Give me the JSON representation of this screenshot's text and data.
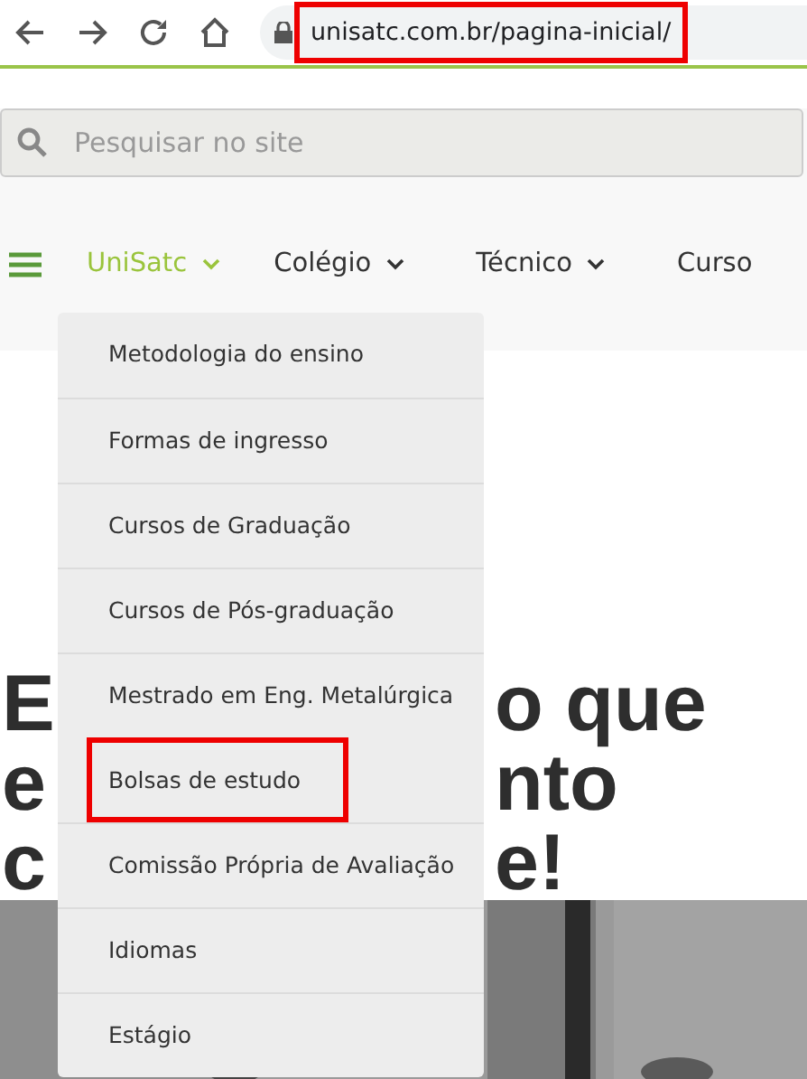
{
  "browser": {
    "url": "unisatc.com.br/pagina-inicial/",
    "url_highlighted": true
  },
  "search": {
    "placeholder": "Pesquisar no site"
  },
  "nav": [
    {
      "label": "UniSatc",
      "selected": true
    },
    {
      "label": "Colégio",
      "selected": false
    },
    {
      "label": "Técnico",
      "selected": false
    },
    {
      "label": "Curso",
      "selected": false
    }
  ],
  "dropdown": [
    {
      "label": "Metodologia do ensino",
      "highlighted": false
    },
    {
      "label": "Formas de ingresso",
      "highlighted": false
    },
    {
      "label": "Cursos de Graduação",
      "highlighted": false
    },
    {
      "label": "Cursos de Pós-graduação",
      "highlighted": false
    },
    {
      "label": "Mestrado em Eng. Metalúrgica",
      "highlighted": false
    },
    {
      "label": "Bolsas de estudo",
      "highlighted": true
    },
    {
      "label": "Comissão Própria de Avaliação",
      "highlighted": false
    },
    {
      "label": "Idiomas",
      "highlighted": false
    },
    {
      "label": "Estágio",
      "highlighted": false
    }
  ],
  "hero_heading": [
    {
      "left": "E",
      "right": "o que"
    },
    {
      "left": "e",
      "right": "nto"
    },
    {
      "left": "c",
      "right": "e!"
    }
  ]
}
